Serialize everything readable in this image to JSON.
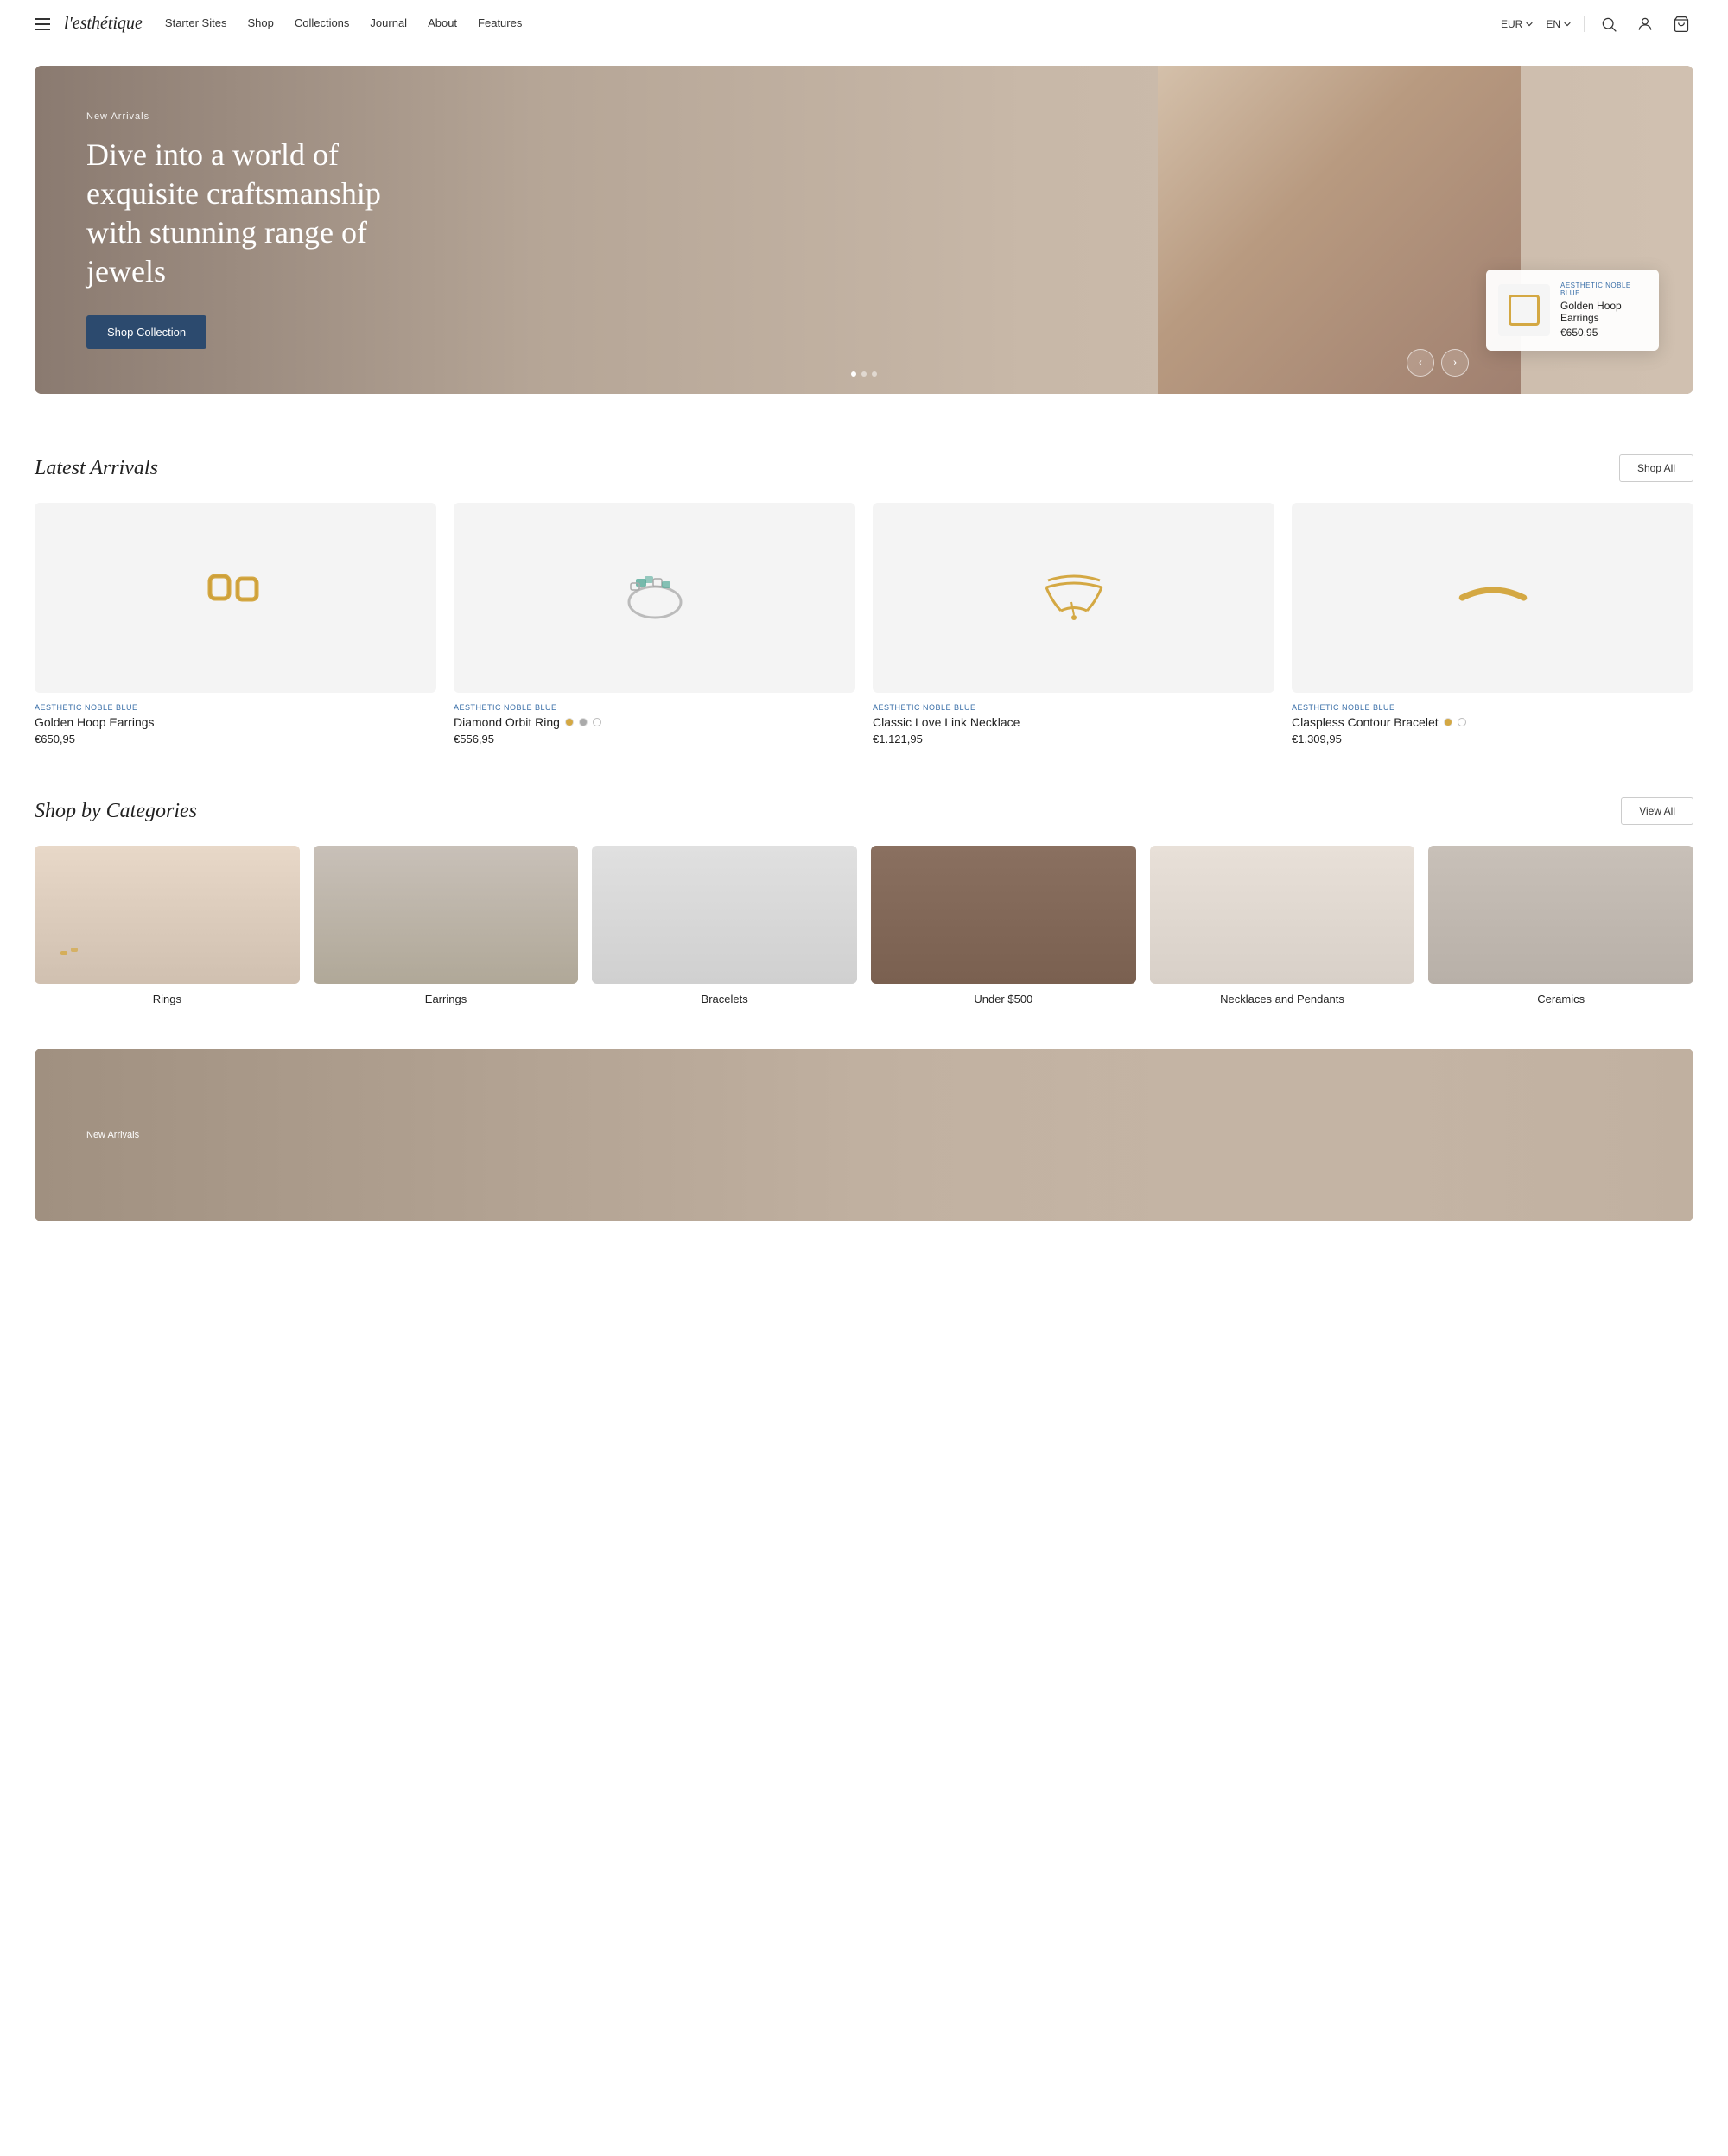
{
  "navbar": {
    "logo": "l'esthétique",
    "menu_icon": "menu-icon",
    "links": [
      {
        "label": "Starter Sites",
        "href": "#"
      },
      {
        "label": "Shop",
        "href": "#"
      },
      {
        "label": "Collections",
        "href": "#"
      },
      {
        "label": "Journal",
        "href": "#"
      },
      {
        "label": "About",
        "href": "#"
      },
      {
        "label": "Features",
        "href": "#"
      }
    ],
    "currency": "EUR",
    "language": "EN",
    "search_icon": "search-icon",
    "account_icon": "account-icon",
    "cart_icon": "cart-icon"
  },
  "hero": {
    "tag": "New Arrivals",
    "title": "Dive into a world of exquisite craftsmanship with stunning range of jewels",
    "cta_label": "Shop Collection",
    "product_brand": "AESTHETIC NOBLE BLUE",
    "product_name": "Golden Hoop Earrings",
    "product_price": "€650,95",
    "prev_label": "‹",
    "next_label": "›",
    "dots": [
      true,
      false,
      false
    ]
  },
  "latest_arrivals": {
    "title": "Latest Arrivals",
    "shop_all_label": "Shop All",
    "products": [
      {
        "brand": "AESTHETIC NOBLE BLUE",
        "name": "Golden Hoop Earrings",
        "price": "€650,95",
        "colors": [],
        "type": "earring"
      },
      {
        "brand": "AESTHETIC NOBLE BLUE",
        "name": "Diamond Orbit Ring",
        "price": "€556,95",
        "colors": [
          "gold",
          "silver",
          "white"
        ],
        "type": "ring"
      },
      {
        "brand": "AESTHETIC NOBLE BLUE",
        "name": "Classic Love Link Necklace",
        "price": "€1.121,95",
        "colors": [],
        "type": "necklace"
      },
      {
        "brand": "AESTHETIC NOBLE BLUE",
        "name": "Claspless Contour Bracelet",
        "price": "€1.309,95",
        "colors": [
          "gold",
          "white"
        ],
        "type": "bracelet"
      }
    ]
  },
  "categories": {
    "title": "Shop by Categories",
    "view_all_label": "View All",
    "items": [
      {
        "label": "Rings",
        "type": "rings"
      },
      {
        "label": "Earrings",
        "type": "earrings"
      },
      {
        "label": "Bracelets",
        "type": "bracelets"
      },
      {
        "label": "Under $500",
        "type": "under500"
      },
      {
        "label": "Necklaces and Pendants",
        "type": "necklaces"
      },
      {
        "label": "Ceramics",
        "type": "ceramics"
      }
    ]
  },
  "second_hero": {
    "tag": "New Arrivals"
  }
}
